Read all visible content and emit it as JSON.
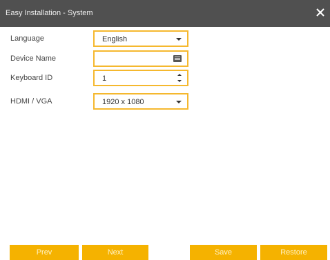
{
  "window": {
    "title": "Easy Installation - System",
    "close_icon": "close-icon"
  },
  "form": {
    "language": {
      "label": "Language",
      "value": "English"
    },
    "device_name": {
      "label": "Device Name",
      "value": ""
    },
    "keyboard_id": {
      "label": "Keyboard ID",
      "value": "1"
    },
    "hdmi_vga": {
      "label": "HDMI / VGA",
      "value": "1920 x 1080"
    }
  },
  "buttons": {
    "prev": "Prev",
    "next": "Next",
    "save": "Save",
    "restore": "Restore"
  },
  "colors": {
    "titlebar": "#505050",
    "accent": "#f5b200",
    "field_border": "#f5b82e"
  }
}
